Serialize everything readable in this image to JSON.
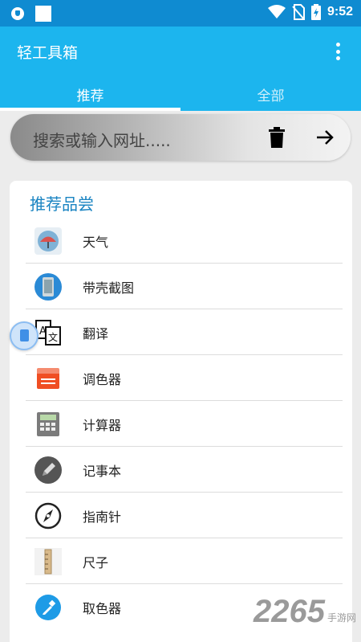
{
  "status_bar": {
    "time": "9:52",
    "icons": [
      "shield-icon",
      "notification-square-icon",
      "wifi-icon",
      "no-sim-icon",
      "battery-charging-icon"
    ]
  },
  "app_bar": {
    "title": "轻工具箱",
    "menu_icon": "more-vertical-icon"
  },
  "tabs": [
    {
      "label": "推荐",
      "active": true
    },
    {
      "label": "全部",
      "active": false
    }
  ],
  "search": {
    "placeholder": "搜索或输入网址.....",
    "clear_icon": "trash-icon",
    "go_icon": "arrow-right-icon"
  },
  "section": {
    "title": "推荐品尝",
    "items": [
      {
        "label": "天气",
        "icon": "weather-umbrella-icon"
      },
      {
        "label": "带壳截图",
        "icon": "phone-screenshot-icon"
      },
      {
        "label": "翻译",
        "icon": "translate-icon"
      },
      {
        "label": "调色器",
        "icon": "palette-document-icon"
      },
      {
        "label": "计算器",
        "icon": "calculator-icon"
      },
      {
        "label": "记事本",
        "icon": "pencil-note-icon"
      },
      {
        "label": "指南针",
        "icon": "compass-icon"
      },
      {
        "label": "尺子",
        "icon": "ruler-icon"
      },
      {
        "label": "取色器",
        "icon": "eyedropper-icon"
      }
    ]
  },
  "watermark": {
    "number": "2265",
    "text": "手游网"
  },
  "colors": {
    "primary": "#1cb5ee",
    "status_bar": "#0f8bd1",
    "section_title": "#1a84c2",
    "background": "#ececec"
  }
}
